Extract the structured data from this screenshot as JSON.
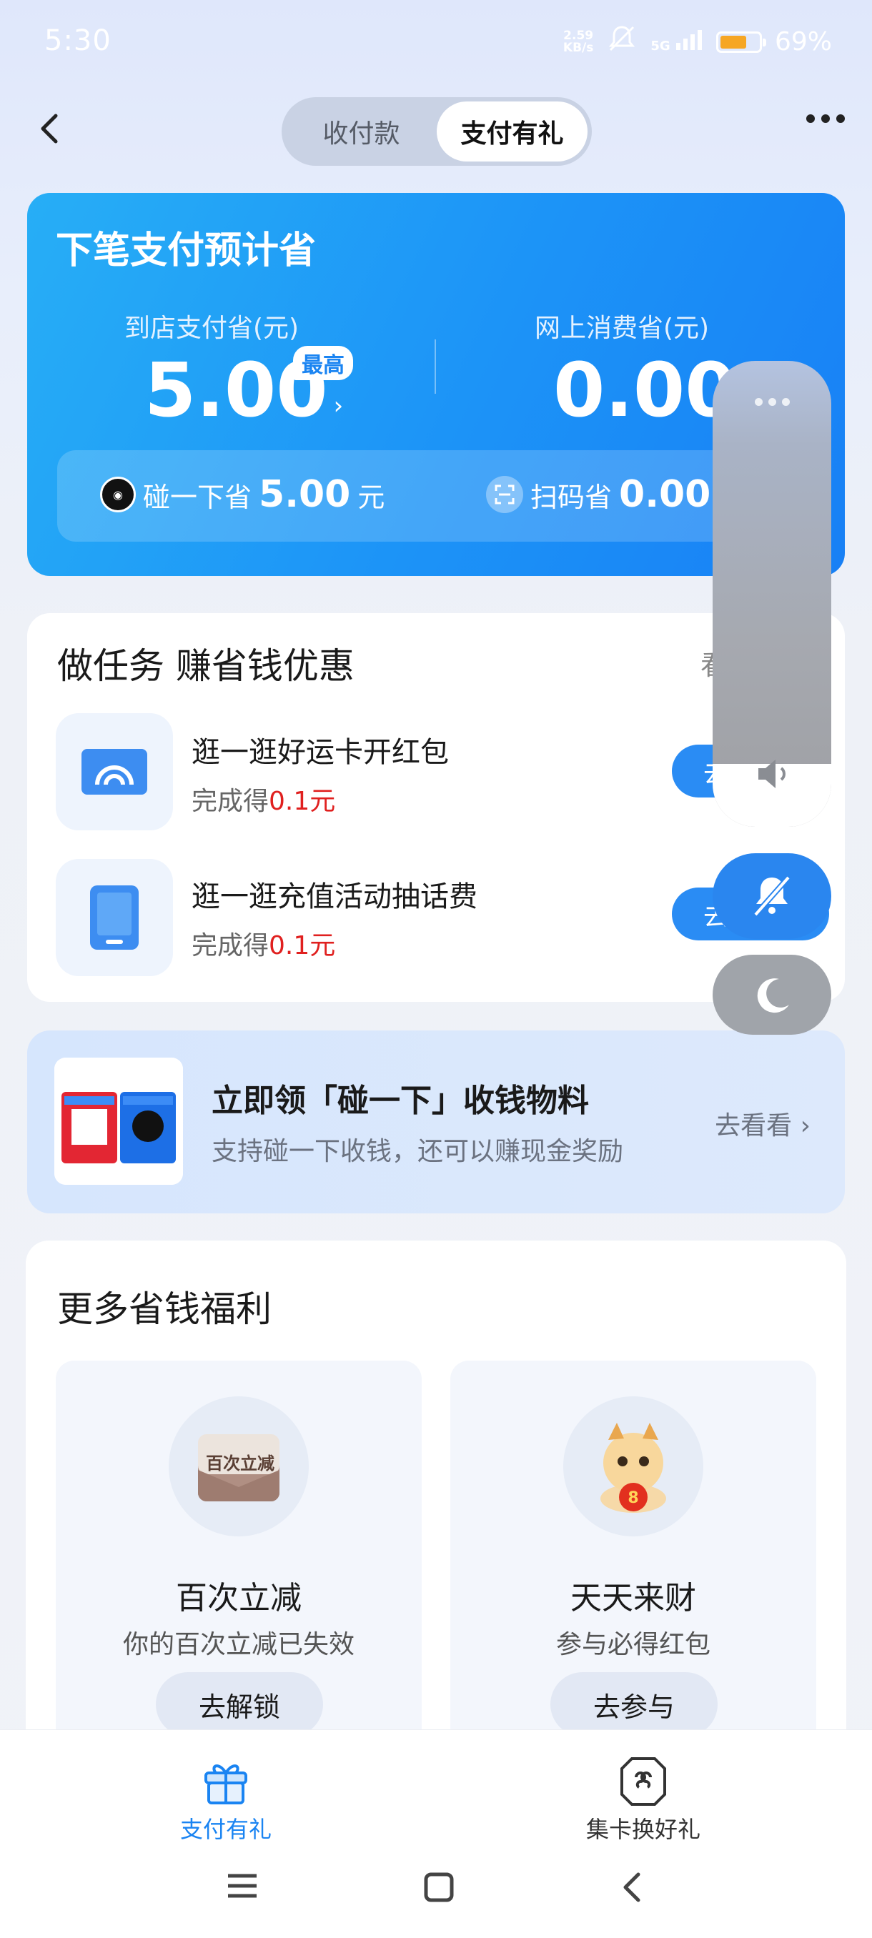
{
  "status_bar": {
    "time": "5:30",
    "net_speed_value": "2.59",
    "net_speed_unit": "KB/s",
    "network": "5G",
    "battery_percent": 69,
    "battery_text": "69%"
  },
  "header": {
    "tabs": [
      {
        "label": "收付款",
        "active": false
      },
      {
        "label": "支付有礼",
        "active": true
      }
    ]
  },
  "savings": {
    "title": "下笔支付预计省",
    "in_store": {
      "label": "到店支付省(元)",
      "amount": "5.00",
      "badge": "最高"
    },
    "online": {
      "label": "网上消费省(元)",
      "amount": "0.00"
    },
    "touch": {
      "label": "碰一下省",
      "amount": "5.00",
      "unit": "元"
    },
    "scan": {
      "label": "扫码省",
      "amount": "0.00"
    }
  },
  "tasks": {
    "title": "做任务 赚省钱优惠",
    "more": "看",
    "items": [
      {
        "name": "逛一逛好运卡开红包",
        "reward_prefix": "完成得",
        "reward": "0.1元",
        "button": "去"
      },
      {
        "name": "逛一逛充值活动抽话费",
        "reward_prefix": "完成得",
        "reward": "0.1元",
        "button": "去"
      }
    ]
  },
  "banner": {
    "title": "立即领「碰一下」收钱物料",
    "subtitle": "支持碰一下收钱，还可以赚现金奖励",
    "link": "去看看"
  },
  "benefits": {
    "title": "更多省钱福利",
    "items": [
      {
        "name": "百次立减",
        "desc": "你的百次立减已失效",
        "button": "去解锁",
        "logo_text": "百次立减"
      },
      {
        "name": "天天来财",
        "desc": "参与必得红包",
        "button": "去参与"
      }
    ]
  },
  "bottom_nav": {
    "items": [
      {
        "label": "支付有礼",
        "icon": "gift-icon",
        "active": true
      },
      {
        "label": "集卡换好礼",
        "icon": "card-icon",
        "active": false
      }
    ]
  },
  "colors": {
    "accent": "#1a84f2",
    "reward_red": "#e0201f"
  }
}
